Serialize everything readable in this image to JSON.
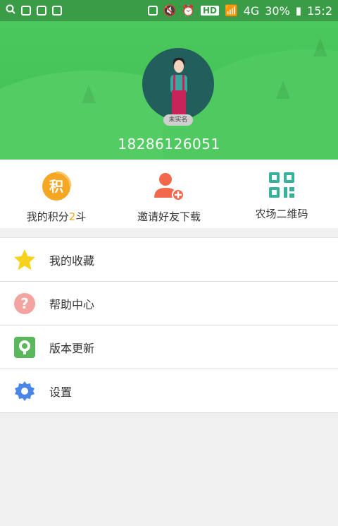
{
  "status_bar": {
    "battery": "30%",
    "time": "15:2",
    "network": "4G",
    "hd": "HD"
  },
  "profile": {
    "phone": "18286126051",
    "avatar_badge": "未实名"
  },
  "quick_actions": [
    {
      "icon_text": "积",
      "label_prefix": "我的积分",
      "label_highlight": "2",
      "label_suffix": "斗"
    },
    {
      "label": "邀请好友下载"
    },
    {
      "label": "农场二维码"
    }
  ],
  "menu": [
    {
      "label": "我的收藏"
    },
    {
      "label": "帮助中心"
    },
    {
      "label": "版本更新"
    },
    {
      "label": "设置"
    }
  ],
  "colors": {
    "header_green": "#45c357",
    "points_orange": "#f5a623",
    "invite_red": "#f2684a",
    "qr_teal": "#38b29b",
    "star_yellow": "#f7d21c",
    "help_pink": "#f3a3a0",
    "update_green": "#5bb75b",
    "settings_blue": "#4a86e8"
  }
}
